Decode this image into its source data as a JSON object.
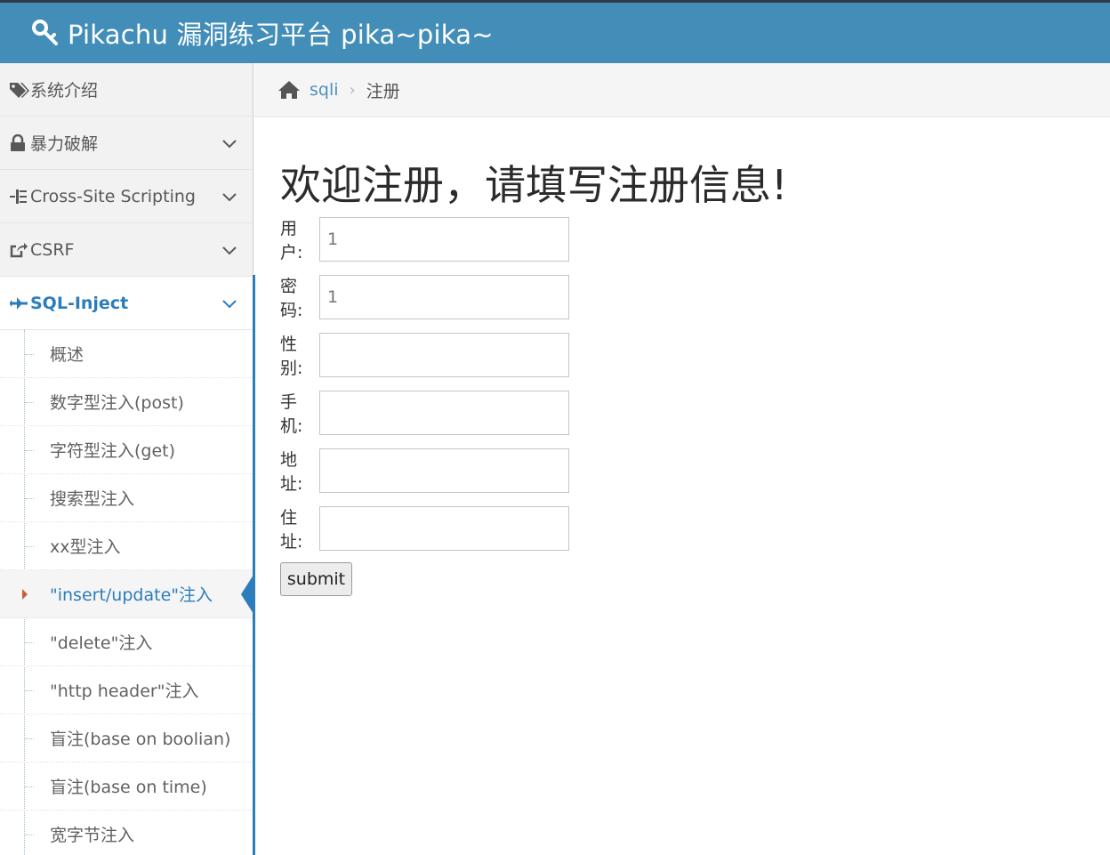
{
  "header": {
    "title": "Pikachu 漏洞练习平台 pika~pika~",
    "icon": "key-icon"
  },
  "sidebar": {
    "items": [
      {
        "label": "系统介绍",
        "icon": "tags-icon"
      },
      {
        "label": "暴力破解",
        "icon": "lock-icon"
      },
      {
        "label": "Cross-Site Scripting",
        "icon": "list-icon"
      },
      {
        "label": "CSRF",
        "icon": "share-square-icon"
      },
      {
        "label": "SQL-Inject",
        "icon": "plane-icon"
      }
    ],
    "sql_submenu": [
      "概述",
      "数字型注入(post)",
      "字符型注入(get)",
      "搜索型注入",
      "xx型注入",
      "\"insert/update\"注入",
      "\"delete\"注入",
      "\"http header\"注入",
      "盲注(base on boolian)",
      "盲注(base on time)",
      "宽字节注入"
    ]
  },
  "breadcrumb": {
    "link": "sqli",
    "separator": "›",
    "current": "注册"
  },
  "form": {
    "title": "欢迎注册，请填写注册信息!",
    "fields": [
      {
        "label": "用户:",
        "value": "",
        "placeholder": "1"
      },
      {
        "label": "密码:",
        "value": "",
        "placeholder": "1"
      },
      {
        "label": "性别:",
        "value": "",
        "placeholder": ""
      },
      {
        "label": "手机:",
        "value": "",
        "placeholder": ""
      },
      {
        "label": "地址:",
        "value": "",
        "placeholder": ""
      },
      {
        "label": "住址:",
        "value": "",
        "placeholder": ""
      }
    ],
    "submit_label": "submit"
  },
  "colors": {
    "header_bg": "#438eb9",
    "accent": "#2b7dbc",
    "arrow": "#c86139"
  }
}
